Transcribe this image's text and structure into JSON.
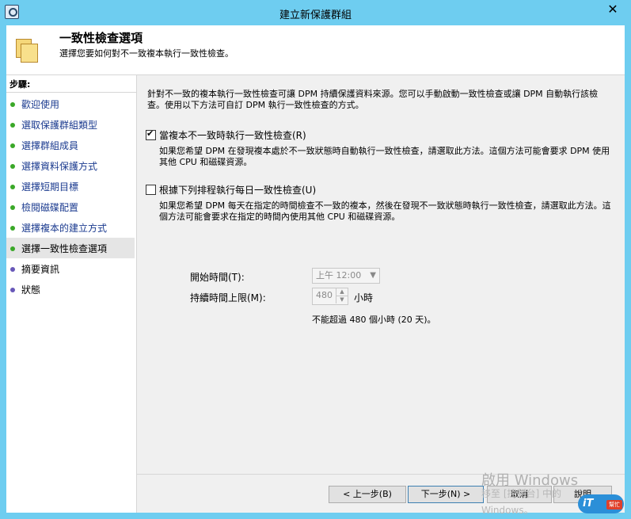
{
  "window": {
    "title": "建立新保護群組",
    "close_glyph": "✕"
  },
  "header": {
    "title": "一致性檢查選項",
    "subtitle": "選擇您要如何對不一致複本執行一致性檢查。"
  },
  "sidebar": {
    "heading": "步驟:",
    "items": [
      {
        "label": "歡迎使用",
        "state": "done"
      },
      {
        "label": "選取保護群組類型",
        "state": "done"
      },
      {
        "label": "選擇群組成員",
        "state": "done"
      },
      {
        "label": "選擇資料保護方式",
        "state": "done"
      },
      {
        "label": "選擇短期目標",
        "state": "done"
      },
      {
        "label": "檢閱磁碟配置",
        "state": "done"
      },
      {
        "label": "選擇複本的建立方式",
        "state": "done"
      },
      {
        "label": "選擇一致性檢查選項",
        "state": "current"
      },
      {
        "label": "摘要資訊",
        "state": "pending"
      },
      {
        "label": "狀態",
        "state": "pending"
      }
    ]
  },
  "content": {
    "intro": "針對不一致的複本執行一致性檢查可讓 DPM 持續保護資料來源。您可以手動啟動一致性檢查或讓 DPM 自動執行該檢查。使用以下方法可自訂 DPM 執行一致性檢查的方式。",
    "option1": {
      "label": "當複本不一致時執行一致性檢查(R)",
      "checked": true,
      "description": "如果您希望 DPM 在發現複本處於不一致狀態時自動執行一致性檢查，請選取此方法。這個方法可能會要求 DPM 使用其他 CPU 和磁碟資源。"
    },
    "option2": {
      "label": "根據下列排程執行每日一致性檢查(U)",
      "checked": false,
      "description": "如果您希望 DPM 每天在指定的時間檢查不一致的複本，然後在發現不一致狀態時執行一致性檢查，請選取此方法。這個方法可能會要求在指定的時間內使用其他 CPU 和磁碟資源。"
    },
    "start_time": {
      "label": "開始時間(T):",
      "value": "上午 12:00"
    },
    "duration": {
      "label": "持續時間上限(M):",
      "value": "480",
      "unit": "小時"
    },
    "limit_note": "不能超過 480 個小時 (20 天)。"
  },
  "buttons": {
    "back": "< 上一步(B)",
    "next": "下一步(N) >",
    "cancel": "取消",
    "help": "說明"
  },
  "watermark": {
    "line1": "啟用 Windows",
    "line2": "移至 [控制台] 中的",
    "line3": "Windows。"
  },
  "badge": {
    "brand": "iT",
    "tag": "幫忙"
  },
  "colors": {
    "titlebar": "#6ecdf0",
    "done_dot": "#3aa828",
    "pending_dot": "#6858b8",
    "link_text": "#1a3a8f"
  }
}
